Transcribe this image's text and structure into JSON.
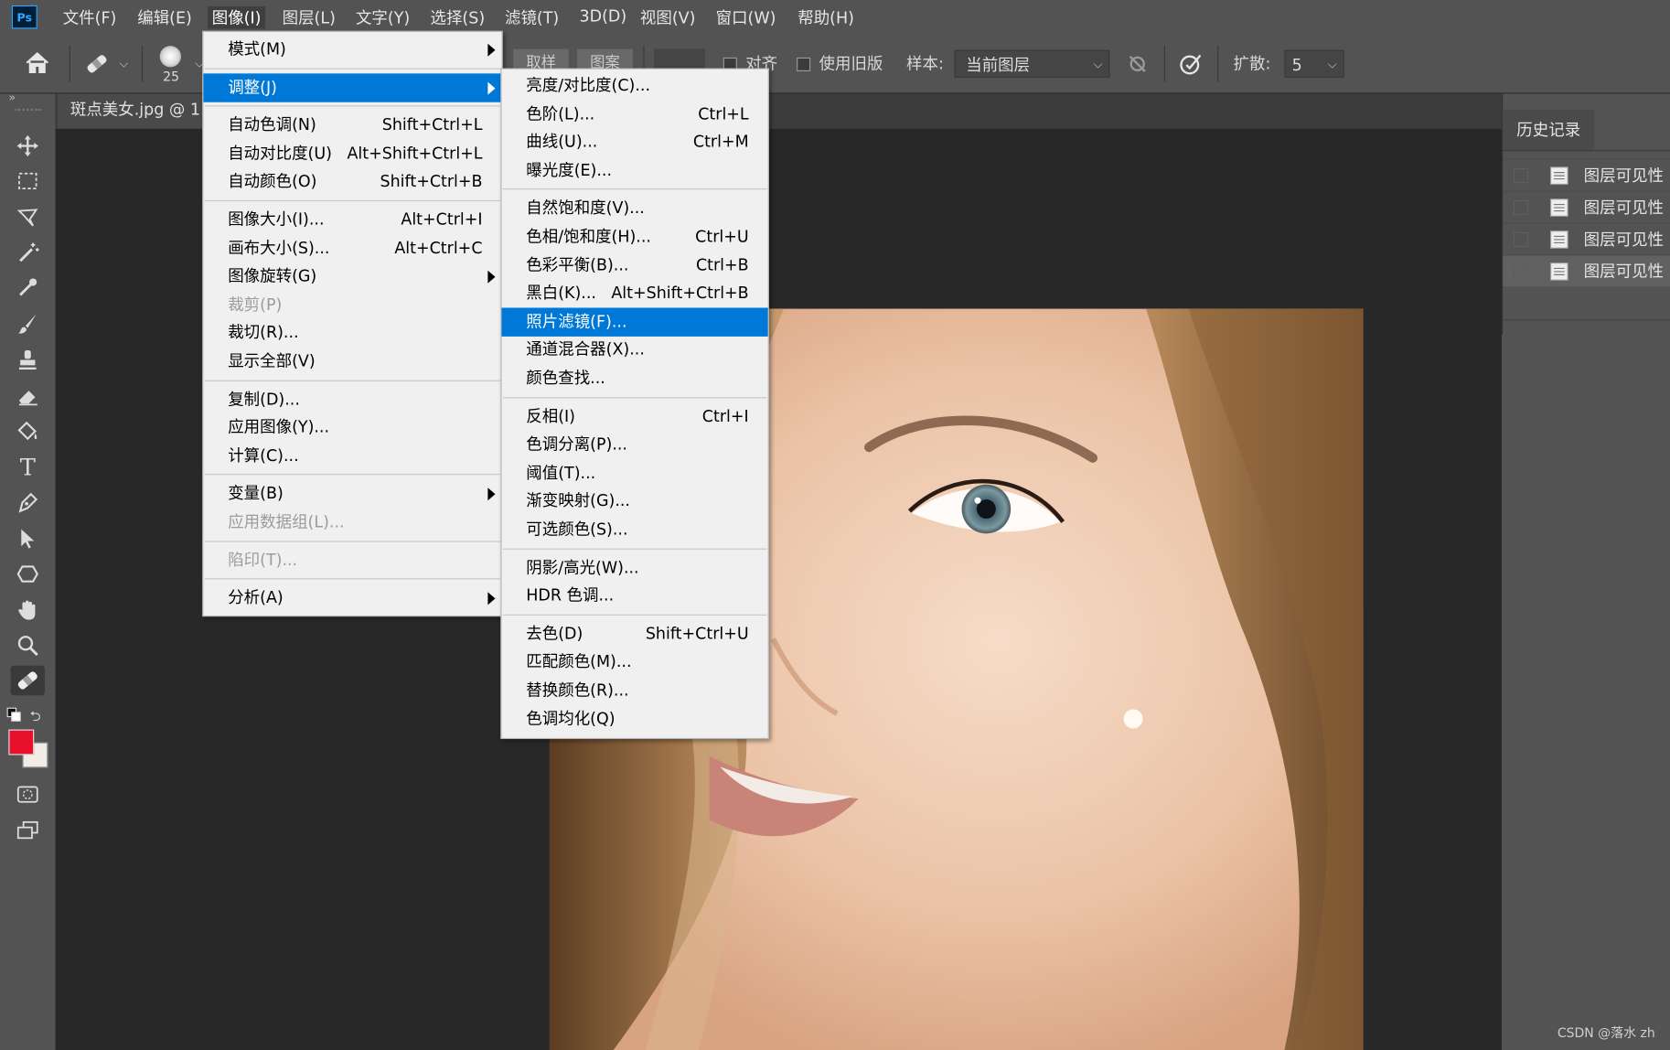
{
  "app": {
    "logo": "Ps"
  },
  "menubar": [
    "文件(F)",
    "编辑(E)",
    "图像(I)",
    "图层(L)",
    "文字(Y)",
    "选择(S)",
    "滤镜(T)",
    "3D(D)",
    "视图(V)",
    "窗口(W)",
    "帮助(H)"
  ],
  "options": {
    "brush_size": "25",
    "tab_sampled": "取样",
    "tab_pattern": "图案",
    "align": "对齐",
    "legacy": "使用旧版",
    "sample_label": "样本:",
    "sample_value": "当前图层",
    "diffusion_label": "扩散:",
    "diffusion_value": "5"
  },
  "document": {
    "tab_title": "斑点美女.jpg @ 1"
  },
  "history": {
    "title": "历史记录",
    "items": [
      "图层可见性",
      "图层可见性",
      "图层可见性",
      "图层可见性"
    ]
  },
  "image_menu": [
    {
      "label": "模式(M)",
      "shortcut": "",
      "submenu": true
    },
    {
      "sep": true
    },
    {
      "label": "调整(J)",
      "shortcut": "",
      "submenu": true,
      "highlight": true
    },
    {
      "sep": true
    },
    {
      "label": "自动色调(N)",
      "shortcut": "Shift+Ctrl+L"
    },
    {
      "label": "自动对比度(U)",
      "shortcut": "Alt+Shift+Ctrl+L"
    },
    {
      "label": "自动颜色(O)",
      "shortcut": "Shift+Ctrl+B"
    },
    {
      "sep": true
    },
    {
      "label": "图像大小(I)...",
      "shortcut": "Alt+Ctrl+I"
    },
    {
      "label": "画布大小(S)...",
      "shortcut": "Alt+Ctrl+C"
    },
    {
      "label": "图像旋转(G)",
      "shortcut": "",
      "submenu": true
    },
    {
      "label": "裁剪(P)",
      "shortcut": "",
      "disabled": true
    },
    {
      "label": "裁切(R)...",
      "shortcut": ""
    },
    {
      "label": "显示全部(V)",
      "shortcut": ""
    },
    {
      "sep": true
    },
    {
      "label": "复制(D)...",
      "shortcut": ""
    },
    {
      "label": "应用图像(Y)...",
      "shortcut": ""
    },
    {
      "label": "计算(C)...",
      "shortcut": ""
    },
    {
      "sep": true
    },
    {
      "label": "变量(B)",
      "shortcut": "",
      "submenu": true
    },
    {
      "label": "应用数据组(L)...",
      "shortcut": "",
      "disabled": true
    },
    {
      "sep": true
    },
    {
      "label": "陷印(T)...",
      "shortcut": "",
      "disabled": true
    },
    {
      "sep": true
    },
    {
      "label": "分析(A)",
      "shortcut": "",
      "submenu": true
    }
  ],
  "adjust_menu": [
    {
      "label": "亮度/对比度(C)...",
      "shortcut": ""
    },
    {
      "label": "色阶(L)...",
      "shortcut": "Ctrl+L"
    },
    {
      "label": "曲线(U)...",
      "shortcut": "Ctrl+M"
    },
    {
      "label": "曝光度(E)...",
      "shortcut": ""
    },
    {
      "sep": true
    },
    {
      "label": "自然饱和度(V)...",
      "shortcut": ""
    },
    {
      "label": "色相/饱和度(H)...",
      "shortcut": "Ctrl+U"
    },
    {
      "label": "色彩平衡(B)...",
      "shortcut": "Ctrl+B"
    },
    {
      "label": "黑白(K)...",
      "shortcut": "Alt+Shift+Ctrl+B"
    },
    {
      "label": "照片滤镜(F)...",
      "shortcut": "",
      "highlight": true
    },
    {
      "label": "通道混合器(X)...",
      "shortcut": ""
    },
    {
      "label": "颜色查找...",
      "shortcut": ""
    },
    {
      "sep": true
    },
    {
      "label": "反相(I)",
      "shortcut": "Ctrl+I"
    },
    {
      "label": "色调分离(P)...",
      "shortcut": ""
    },
    {
      "label": "阈值(T)...",
      "shortcut": ""
    },
    {
      "label": "渐变映射(G)...",
      "shortcut": ""
    },
    {
      "label": "可选颜色(S)...",
      "shortcut": ""
    },
    {
      "sep": true
    },
    {
      "label": "阴影/高光(W)...",
      "shortcut": ""
    },
    {
      "label": "HDR 色调...",
      "shortcut": ""
    },
    {
      "sep": true
    },
    {
      "label": "去色(D)",
      "shortcut": "Shift+Ctrl+U"
    },
    {
      "label": "匹配颜色(M)...",
      "shortcut": ""
    },
    {
      "label": "替换颜色(R)...",
      "shortcut": ""
    },
    {
      "label": "色调均化(Q)",
      "shortcut": ""
    }
  ],
  "colors": {
    "foreground": "#e8112d",
    "background": "#f2ece6",
    "highlight": "#0078d7"
  },
  "watermark": "CSDN @落水 zh"
}
